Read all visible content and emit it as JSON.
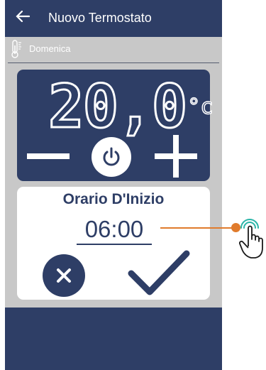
{
  "header": {
    "back_icon": "arrow-left-icon",
    "title": "Nuovo Termostato"
  },
  "day": {
    "icon": "thermometer-icon",
    "label": "Domenica"
  },
  "thermostat": {
    "temperature": "20,0",
    "unit": "°c",
    "minus_icon": "minus-icon",
    "power_icon": "power-icon",
    "plus_icon": "plus-icon"
  },
  "start_time": {
    "title": "Orario D'Inizio",
    "value": "06:00",
    "cancel_icon": "close-icon",
    "confirm_icon": "checkmark-icon"
  },
  "annotation": {
    "icon": "tap-gesture-icon"
  },
  "colors": {
    "primary": "#2e3e66",
    "background": "#c8c8c8",
    "accent": "#e07b2c",
    "gesture": "#2bb5a8"
  }
}
